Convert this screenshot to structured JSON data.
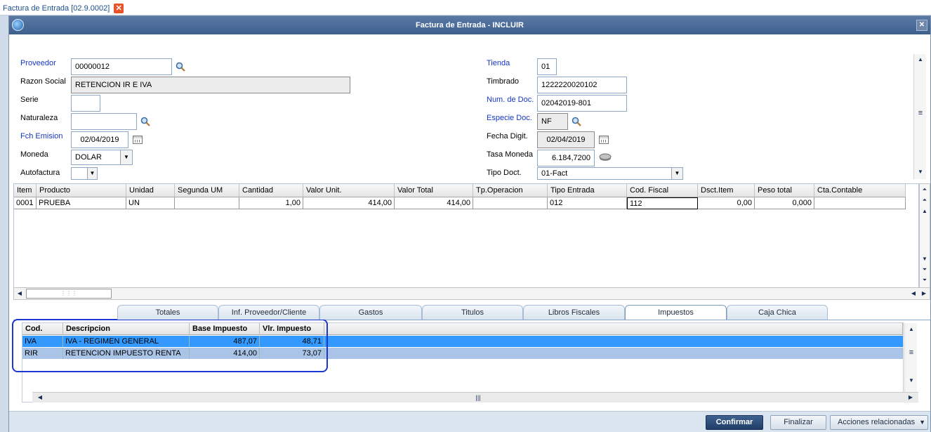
{
  "doc_tab": {
    "title": "Factura de Entrada [02.9.0002]"
  },
  "window": {
    "title": "Factura de Entrada - INCLUIR"
  },
  "form": {
    "proveedor_label": "Proveedor",
    "proveedor_value": "00000012",
    "razon_social_label": "Razon Social",
    "razon_social_value": "RETENCION IR E IVA",
    "serie_label": "Serie",
    "serie_value": "",
    "naturaleza_label": "Naturaleza",
    "naturaleza_value": "",
    "fch_emision_label": "Fch Emision",
    "fch_emision_value": "02/04/2019",
    "moneda_label": "Moneda",
    "moneda_value": "DOLAR",
    "autofactura_label": "Autofactura",
    "autofactura_value": "",
    "tienda_label": "Tienda",
    "tienda_value": "01",
    "timbrado_label": "Timbrado",
    "timbrado_value": "1222220020102",
    "num_doc_label": "Num. de Doc.",
    "num_doc_value": "02042019-801",
    "especie_doc_label": "Especie Doc.",
    "especie_doc_value": "NF",
    "fecha_digit_label": "Fecha Digit.",
    "fecha_digit_value": "02/04/2019",
    "tasa_moneda_label": "Tasa Moneda",
    "tasa_moneda_value": "6.184,7200",
    "tipo_doct_label": "Tipo Doct.",
    "tipo_doct_value": "01-Fact"
  },
  "items_grid": {
    "columns": [
      "Item",
      "Producto",
      "Unidad",
      "Segunda UM",
      "Cantidad",
      "Valor Unit.",
      "Valor Total",
      "Tp.Operacion",
      "Tipo Entrada",
      "Cod. Fiscal",
      "Dsct.Item",
      "Peso total",
      "Cta.Contable"
    ],
    "rows": [
      [
        "0001",
        "PRUEBA",
        "UN",
        "",
        "1,00",
        "414,00",
        "414,00",
        "",
        "012",
        "112",
        "0,00",
        "0,000",
        ""
      ]
    ]
  },
  "tabs": [
    "Totales",
    "Inf. Proveedor/Cliente",
    "Gastos",
    "Titulos",
    "Libros Fiscales",
    "Impuestos",
    "Caja Chica"
  ],
  "active_tab": "Impuestos",
  "taxes_grid": {
    "columns": [
      "Cod.",
      "Descripcion",
      "Base Impuesto",
      "Vlr. Impuesto"
    ],
    "rows": [
      [
        "IVA",
        "IVA - REGIMEN GENERAL",
        "487,07",
        "48,71"
      ],
      [
        "RIR",
        "RETENCION IMPUESTO RENTA",
        "414,00",
        "73,07"
      ]
    ]
  },
  "buttons": {
    "confirm": "Confirmar",
    "finalize": "Finalizar",
    "related_actions": "Acciones relacionadas"
  },
  "colors": {
    "title_bar": "#4a6b97",
    "selected_row": "#3399ff",
    "selected_row_2": "#a9c4e6",
    "highlight_border": "#1c36d1",
    "primary_button": "#2a4a77"
  }
}
